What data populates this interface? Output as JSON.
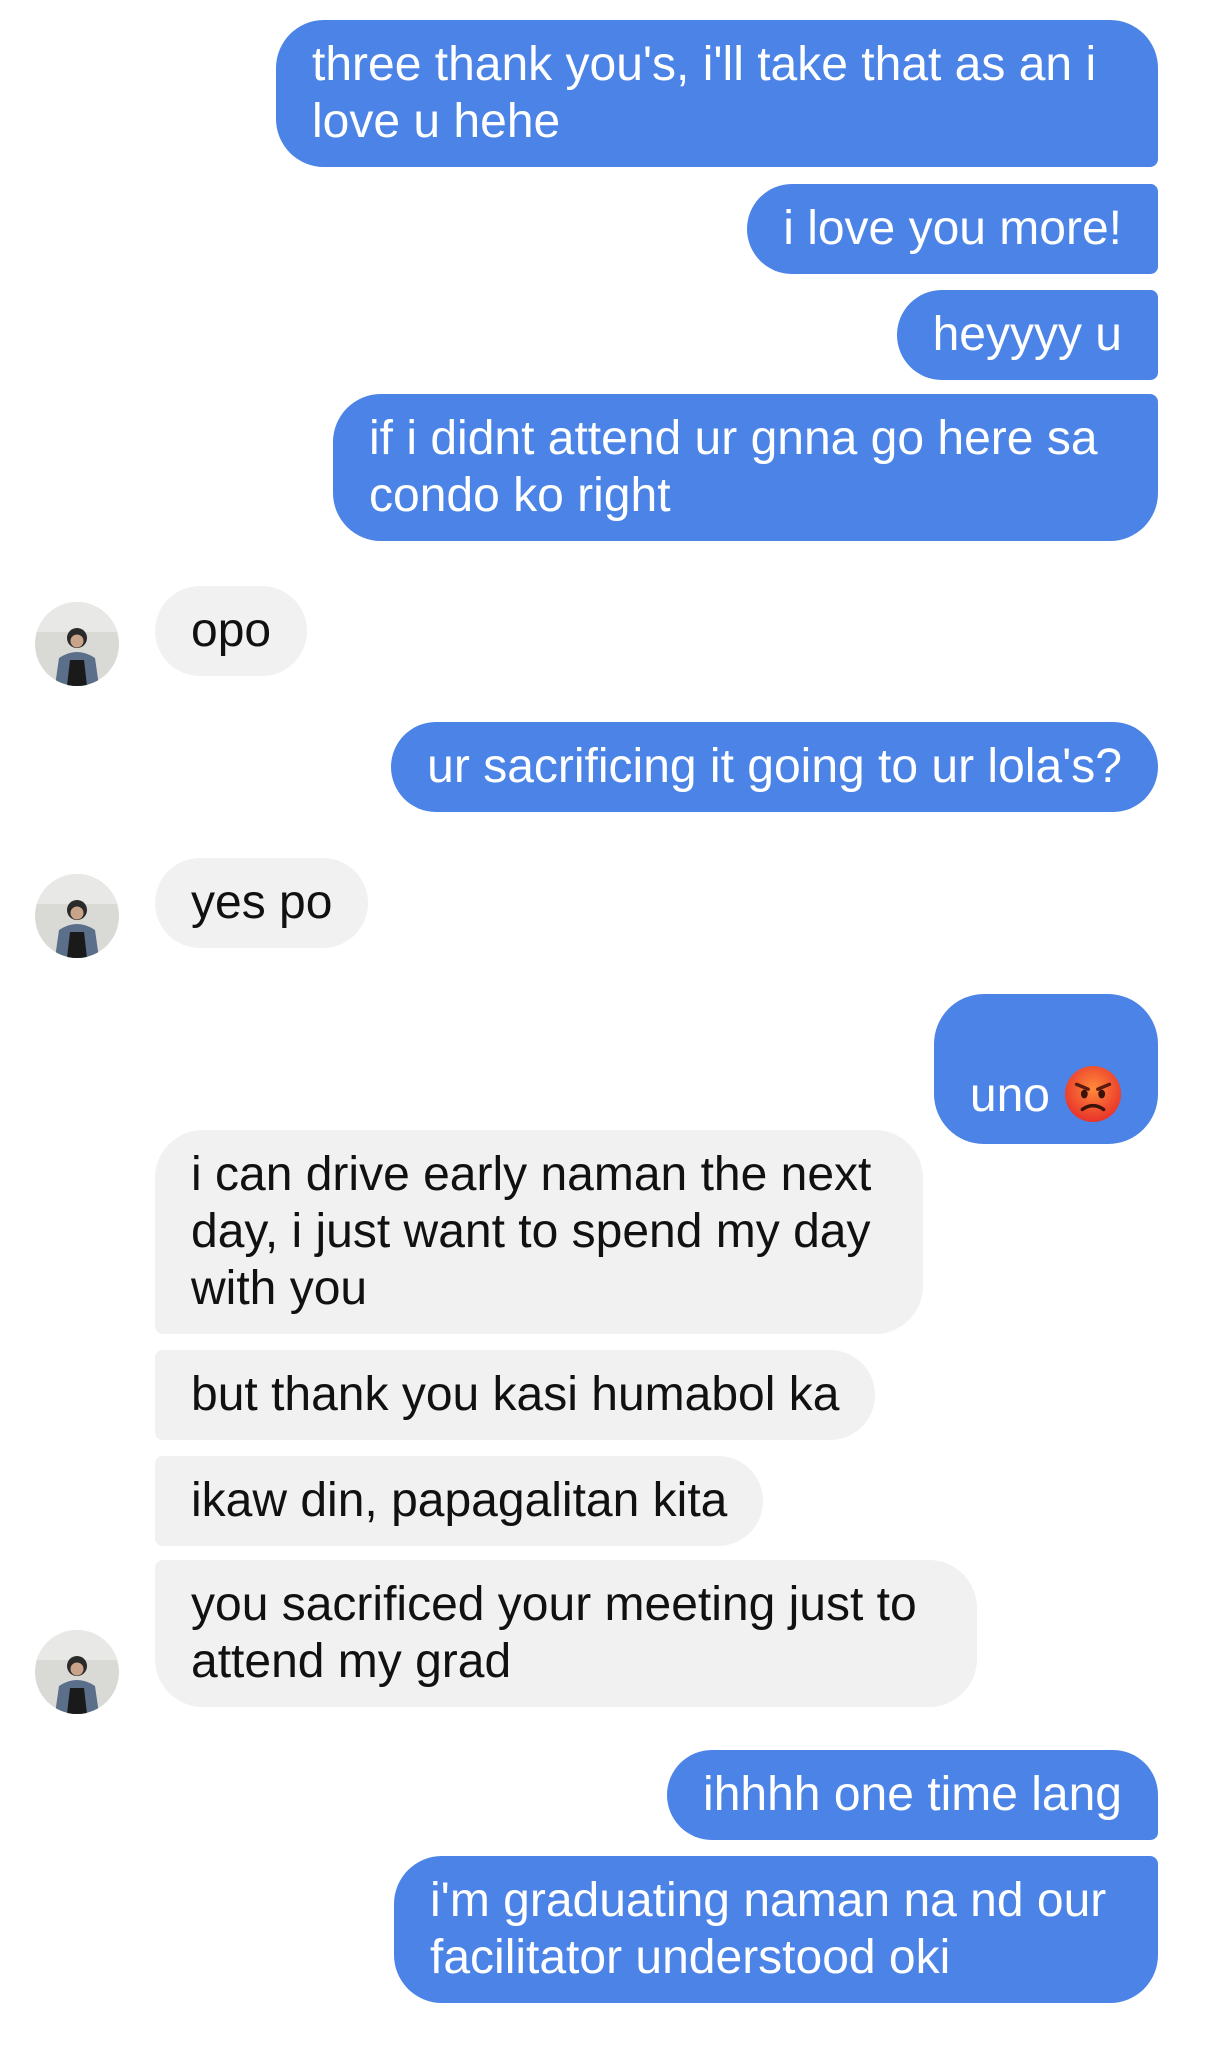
{
  "messages": [
    {
      "text": "three thank you's, i'll take that as an i\nlove u hehe"
    },
    {
      "text": "i love you more!"
    },
    {
      "text": "heyyyy u"
    },
    {
      "text": "if i didnt attend ur gnna go here sa\ncondo ko right"
    },
    {
      "text": "opo"
    },
    {
      "text": "ur sacrificing it going to ur lola's?"
    },
    {
      "text": "yes po"
    },
    {
      "text": "uno",
      "emoji": "angry-face-icon"
    },
    {
      "text": "i can drive early naman the next\nday, i just want to spend my day\nwith you"
    },
    {
      "text": "but thank you kasi humabol ka"
    },
    {
      "text": "ikaw din, papagalitan kita"
    },
    {
      "text": "you sacrificed your meeting just to\nattend my grad"
    },
    {
      "text": "ihhhh one time lang"
    },
    {
      "text": "i'm graduating naman na nd our\nfacilitator understood oki"
    }
  ],
  "colors": {
    "sent_bubble": "#4b84e6",
    "received_bubble": "#f1f1f2",
    "sent_text": "#ffffff",
    "received_text": "#111111"
  }
}
